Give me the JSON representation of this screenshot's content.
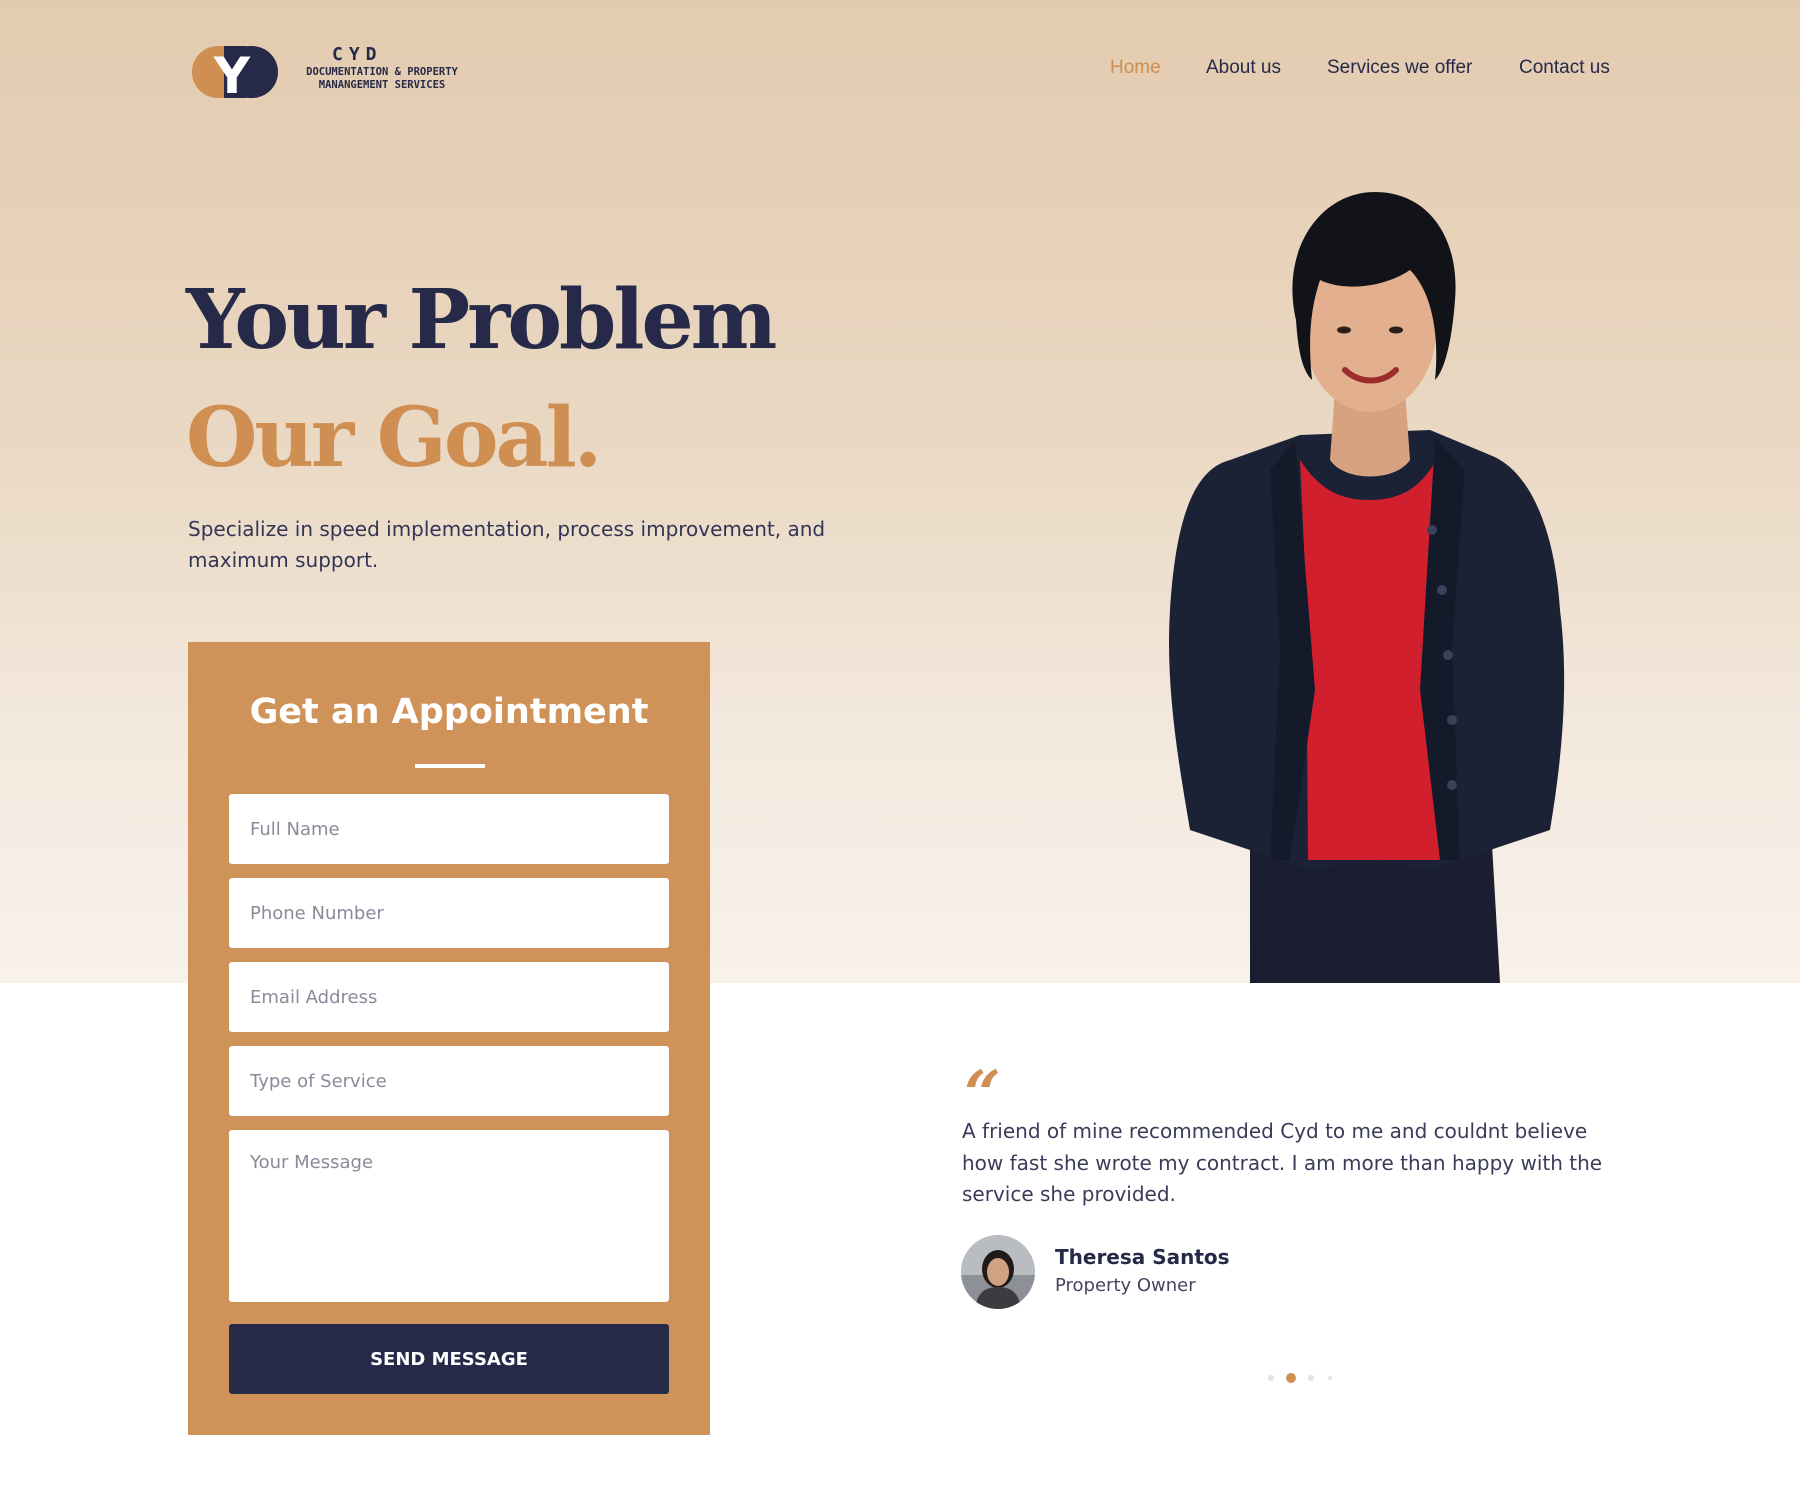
{
  "brand": {
    "logo_letter": "Y",
    "name": "CYD",
    "tagline": "DOCUMENTATION & PROPERTY\nMANANGEMENT SERVICES"
  },
  "nav": {
    "items": [
      {
        "label": "Home",
        "active": true
      },
      {
        "label": "About us",
        "active": false
      },
      {
        "label": "Services we offer",
        "active": false
      },
      {
        "label": "Contact us",
        "active": false
      }
    ]
  },
  "hero": {
    "line1": "Your Problem",
    "line2": "Our Goal.",
    "description": "Specialize in speed implementation, process improvement, and maximum support."
  },
  "form": {
    "title": "Get an Appointment",
    "full_name_placeholder": "Full Name",
    "phone_placeholder": "Phone Number",
    "email_placeholder": "Email Address",
    "service_placeholder": "Type of Service",
    "message_placeholder": "Your Message",
    "submit_label": "SEND MESSAGE"
  },
  "testimonial": {
    "quote_mark": "“",
    "text": "A friend of mine recommended Cyd to me and couldnt believe how fast she wrote my contract. I am more than happy with the service she provided.",
    "author_name": "Theresa Santos",
    "author_role": "Property Owner",
    "slide_count": 4,
    "active_slide": 2
  },
  "colors": {
    "navy": "#262a48",
    "accent": "#cf8f53",
    "form_bg": "#cf9258",
    "hero_bg_top": "#e3cbaf",
    "jacket": "#1c2236",
    "shirt": "#d11f2e"
  },
  "icons": [
    "logo-mark-icon",
    "quote-icon"
  ]
}
